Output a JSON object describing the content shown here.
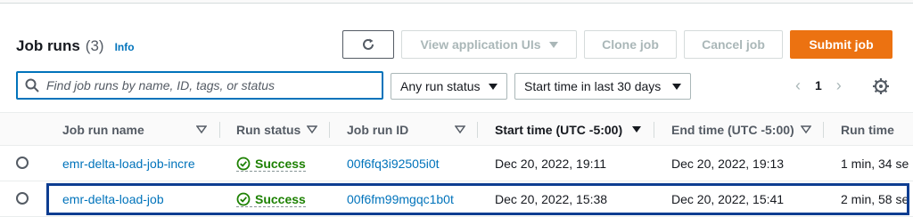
{
  "header": {
    "title": "Job runs",
    "count": "(3)",
    "info": "Info"
  },
  "toolbar": {
    "view_label": "View application UIs",
    "clone_label": "Clone job",
    "cancel_label": "Cancel job",
    "submit_label": "Submit job"
  },
  "filters": {
    "search_placeholder": "Find job runs by name, ID, tags, or status",
    "status_value": "Any run status",
    "time_value": "Start time in last 30 days"
  },
  "pagination": {
    "current_page": "1"
  },
  "table": {
    "columns": [
      "Job run name",
      "Run status",
      "Job run ID",
      "Start time (UTC -5:00)",
      "End time (UTC -5:00)",
      "Run time"
    ],
    "rows": [
      {
        "name": "emr-delta-load-job-incre",
        "status": "Success",
        "id": "00f6fq3i92505i0t",
        "start": "Dec 20, 2022, 19:11",
        "end": "Dec 20, 2022, 19:13",
        "runtime": "1 min, 34 se"
      },
      {
        "name": "emr-delta-load-job",
        "status": "Success",
        "id": "00f6fm99mgqc1b0t",
        "start": "Dec 20, 2022, 15:38",
        "end": "Dec 20, 2022, 15:41",
        "runtime": "2 min, 58 se"
      }
    ]
  },
  "colors": {
    "accent": "#0073bb",
    "primary_button": "#ec7211",
    "success": "#1d8102",
    "selection_border": "#0d3d91"
  },
  "icons": [
    "refresh-icon",
    "search-icon",
    "chevron-left-icon",
    "chevron-right-icon",
    "gear-icon",
    "success-check-icon",
    "sort-icon"
  ]
}
